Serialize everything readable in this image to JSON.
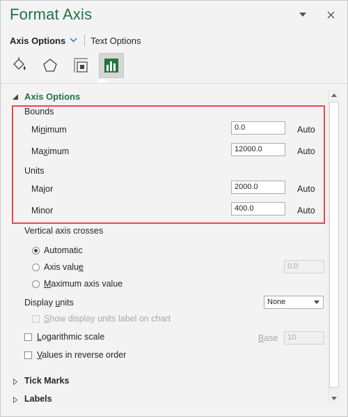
{
  "pane": {
    "title": "Format Axis",
    "tabs": [
      {
        "label": "Axis Options",
        "active": true
      },
      {
        "label": "Text Options",
        "active": false
      }
    ],
    "icons": [
      "fill-line-icon",
      "effects-icon",
      "size-properties-icon",
      "axis-options-icon"
    ]
  },
  "axis_options": {
    "section_label": "Axis Options",
    "bounds_label": "Bounds",
    "minimum": {
      "label_pre": "Mi",
      "label_u": "n",
      "label_post": "imum",
      "value": "0.0",
      "mode": "Auto"
    },
    "maximum": {
      "label_pre": "Ma",
      "label_u": "x",
      "label_post": "imum",
      "value": "12000.0",
      "mode": "Auto"
    },
    "units_label": "Units",
    "major": {
      "label": "Major",
      "value": "2000.0",
      "mode": "Auto"
    },
    "minor": {
      "label": "Minor",
      "value": "400.0",
      "mode": "Auto"
    },
    "vertical_axis_crosses_label": "Vertical axis crosses",
    "crosses_options": [
      {
        "label": "Automatic",
        "selected": true
      },
      {
        "label_pre": "Axis valu",
        "label_u": "e",
        "label_post": "",
        "selected": false,
        "value": "0.0"
      },
      {
        "label_pre": "",
        "label_u": "M",
        "label_post": "aximum axis value",
        "selected": false
      }
    ],
    "display_units": {
      "label_pre": "Display ",
      "label_u": "u",
      "label_post": "nits",
      "value": "None"
    },
    "show_units_label": {
      "label_pre": "",
      "label_u": "S",
      "label_post": "how display units label on chart",
      "checked": false,
      "enabled": false
    },
    "logarithmic": {
      "label_pre": "",
      "label_u": "L",
      "label_post": "ogarithmic scale",
      "checked": false,
      "base_label_pre": "",
      "base_label_u": "B",
      "base_label_post": "ase",
      "base_value": "10"
    },
    "reverse": {
      "label_pre": "",
      "label_u": "V",
      "label_post": "alues in reverse order",
      "checked": false
    }
  },
  "sections": [
    {
      "label": "Tick Marks"
    },
    {
      "label": "Labels"
    }
  ],
  "colors": {
    "accent": "#217346",
    "highlight": "#e8484a",
    "tab_chevron": "#2b6fb8"
  }
}
